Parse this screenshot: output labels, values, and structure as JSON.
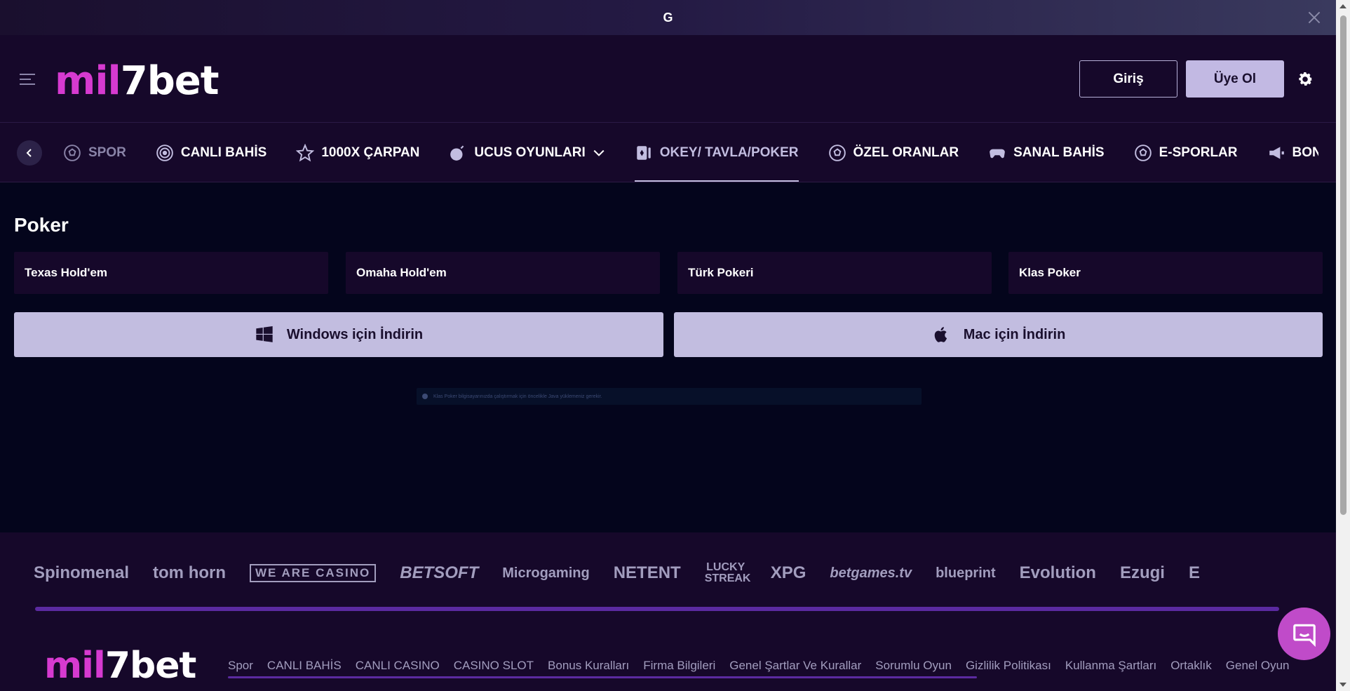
{
  "topbar": {
    "text": "G"
  },
  "header": {
    "logo_part1": "mil",
    "logo_part2": "7",
    "logo_part3": "bet",
    "login_label": "Giriş",
    "register_label": "Üye Ol"
  },
  "nav": {
    "items": [
      {
        "label": "SPOR",
        "icon": "soccer-ball-icon"
      },
      {
        "label": "CANLI BAHİS",
        "icon": "broadcast-icon"
      },
      {
        "label": "1000X ÇARPAN",
        "icon": "star-icon"
      },
      {
        "label": "UCUS OYUNLARI",
        "icon": "bomb-icon"
      },
      {
        "label": "OKEY/ TAVLA/POKER",
        "icon": "cards-icon"
      },
      {
        "label": "ÖZEL ORANLAR",
        "icon": "soccer-ball-icon"
      },
      {
        "label": "SANAL BAHİS",
        "icon": "gamepad-icon"
      },
      {
        "label": "E-SPORLAR",
        "icon": "soccer-ball-icon"
      },
      {
        "label": "BONUS",
        "icon": "megaphone-icon"
      }
    ]
  },
  "main": {
    "title": "Poker",
    "games": [
      "Texas Hold'em",
      "Omaha Hold'em",
      "Türk Pokeri",
      "Klas Poker"
    ],
    "download_windows": "Windows için İndirin",
    "download_mac": "Mac için İndirin",
    "notice": "Klas Poker bilgisayarınızda çalıştırmak için öncelikle Java yüklemeniz gerekir."
  },
  "providers": [
    "Spinomenal",
    "tom horn",
    "WE ARE CASINO",
    "BETSOFT",
    "Microgaming",
    "NETENT",
    "LUCKY STREAK",
    "XPG",
    "betgames.tv",
    "blueprint",
    "Evolution",
    "Ezugi",
    "E"
  ],
  "footer": {
    "links": [
      "Spor",
      "CANLI BAHİS",
      "CANLI CASINO",
      "CASINO SLOT",
      "Bonus Kuralları",
      "Firma Bilgileri",
      "Genel Şartlar Ve Kurallar",
      "Sorumlu Oyun",
      "Gizlilik Politikası",
      "Kullanma Şartları",
      "Ortaklık",
      "Genel Oyun"
    ]
  },
  "colors": {
    "accent": "#c2bde0",
    "brand_pink": "#d63ad0",
    "bg": "#04051c",
    "panel": "#16082a",
    "chat": "#c04bc9"
  }
}
